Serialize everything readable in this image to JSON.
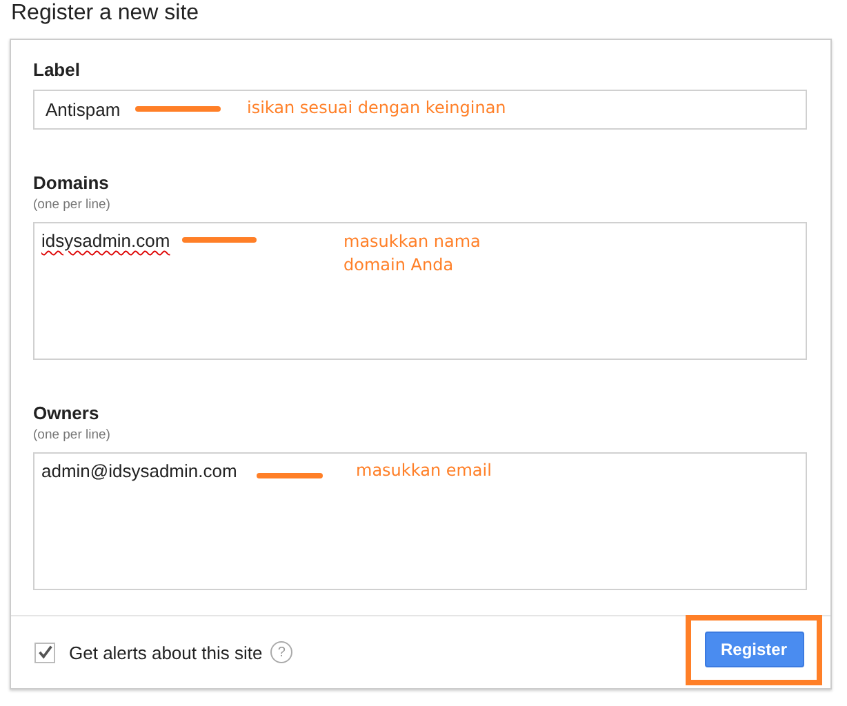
{
  "title": "Register a new site",
  "fields": [
    {
      "kind": "input",
      "label": "Label",
      "value": "Antispam",
      "misspelled": false,
      "annotation": {
        "lines": [
          "isikan sesuai dengan keinginan"
        ]
      }
    },
    {
      "kind": "textarea",
      "label": "Domains",
      "hint": "(one per line)",
      "value": "idsysadmin.com",
      "misspelled": true,
      "annotation": {
        "lines": [
          "masukkan nama",
          "domain Anda"
        ]
      }
    },
    {
      "kind": "textarea",
      "label": "Owners",
      "hint": "(one per line)",
      "value": "admin@idsysadmin.com",
      "misspelled": false,
      "annotation": {
        "lines": [
          "masukkan email"
        ]
      }
    }
  ],
  "alerts": {
    "label": "Get alerts about this site",
    "checked": true,
    "help": "?"
  },
  "register_button": {
    "label": "Register",
    "highlighted": true
  }
}
